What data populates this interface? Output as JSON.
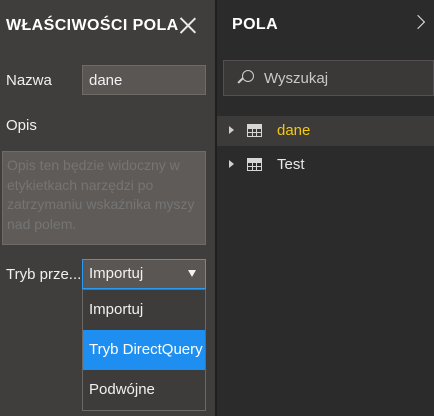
{
  "properties_pane": {
    "title": "WŁAŚCIWOŚCI POLA",
    "name_label": "Nazwa",
    "name_value": "dane",
    "description_label": "Opis",
    "description_placeholder": "Opis ten będzie widoczny w etykietkach narzędzi po zatrzymaniu wskaźnika myszy nad polem.",
    "mode_label": "Tryb prze...",
    "mode_selected": "Importuj",
    "mode_options": [
      "Importuj",
      "Tryb DirectQuery",
      "Podwójne"
    ],
    "highlighted_option": "Tryb DirectQuery"
  },
  "fields_pane": {
    "title": "POLA",
    "search_placeholder": "Wyszukaj",
    "items": [
      {
        "label": "dane",
        "color": "#f2c811",
        "active": true
      },
      {
        "label": "Test",
        "color": "#e8e8e8",
        "active": false
      }
    ]
  },
  "colors": {
    "accent": "#1e8ff0",
    "highlight_text": "#f2c811"
  }
}
